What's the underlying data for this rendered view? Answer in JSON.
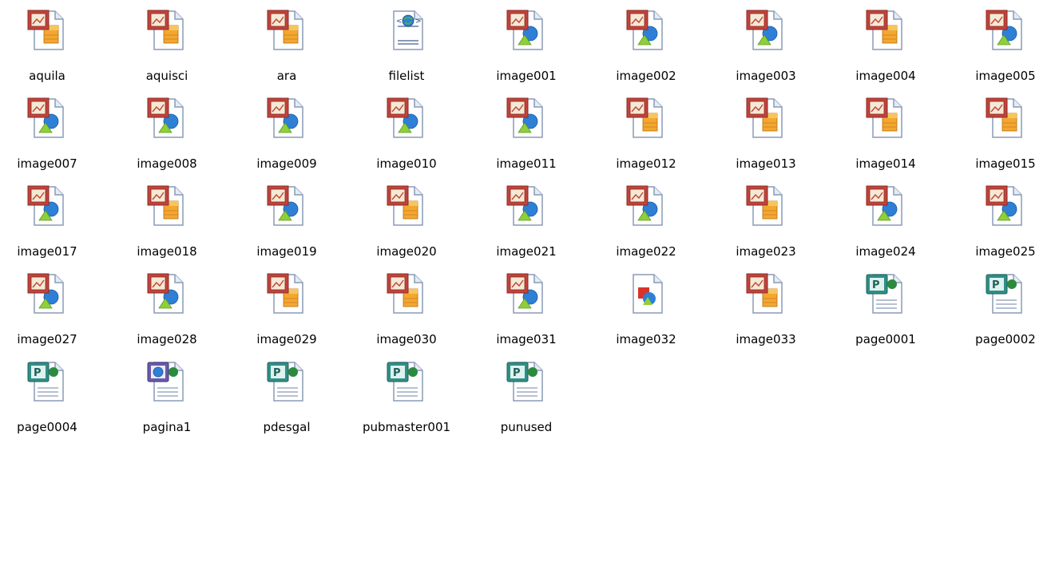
{
  "files": [
    {
      "name": "aquila",
      "icon": "image-bitmap-icon"
    },
    {
      "name": "aquisci",
      "icon": "image-bitmap-icon"
    },
    {
      "name": "ara",
      "icon": "image-bitmap-icon"
    },
    {
      "name": "filelist",
      "icon": "xml-document-icon"
    },
    {
      "name": "image001",
      "icon": "image-picture-icon"
    },
    {
      "name": "image002",
      "icon": "image-picture-icon"
    },
    {
      "name": "image003",
      "icon": "image-picture-icon"
    },
    {
      "name": "image004",
      "icon": "image-bitmap-icon"
    },
    {
      "name": "image005",
      "icon": "image-picture-icon"
    },
    {
      "name": "image007",
      "icon": "image-picture-icon"
    },
    {
      "name": "image008",
      "icon": "image-picture-icon"
    },
    {
      "name": "image009",
      "icon": "image-picture-icon"
    },
    {
      "name": "image010",
      "icon": "image-picture-icon"
    },
    {
      "name": "image011",
      "icon": "image-picture-icon"
    },
    {
      "name": "image012",
      "icon": "image-bitmap-icon"
    },
    {
      "name": "image013",
      "icon": "image-bitmap-icon"
    },
    {
      "name": "image014",
      "icon": "image-bitmap-icon"
    },
    {
      "name": "image015",
      "icon": "image-bitmap-icon"
    },
    {
      "name": "image017",
      "icon": "image-picture-icon"
    },
    {
      "name": "image018",
      "icon": "image-bitmap-icon"
    },
    {
      "name": "image019",
      "icon": "image-picture-icon"
    },
    {
      "name": "image020",
      "icon": "image-bitmap-icon"
    },
    {
      "name": "image021",
      "icon": "image-picture-icon"
    },
    {
      "name": "image022",
      "icon": "image-picture-icon"
    },
    {
      "name": "image023",
      "icon": "image-bitmap-icon"
    },
    {
      "name": "image024",
      "icon": "image-picture-icon"
    },
    {
      "name": "image025",
      "icon": "image-picture-icon"
    },
    {
      "name": "image027",
      "icon": "image-picture-icon"
    },
    {
      "name": "image028",
      "icon": "image-picture-icon"
    },
    {
      "name": "image029",
      "icon": "image-bitmap-icon"
    },
    {
      "name": "image030",
      "icon": "image-bitmap-icon"
    },
    {
      "name": "image031",
      "icon": "image-picture-icon"
    },
    {
      "name": "image032",
      "icon": "image-shape-icon"
    },
    {
      "name": "image033",
      "icon": "image-bitmap-icon"
    },
    {
      "name": "page0001",
      "icon": "publisher-document-icon"
    },
    {
      "name": "page0002",
      "icon": "publisher-document-icon"
    },
    {
      "name": "page0004",
      "icon": "publisher-document-icon"
    },
    {
      "name": "pagina1",
      "icon": "publisher-web-document-icon"
    },
    {
      "name": "pdesgal",
      "icon": "publisher-document-icon"
    },
    {
      "name": "pubmaster001",
      "icon": "publisher-document-icon"
    },
    {
      "name": "punused",
      "icon": "publisher-document-icon"
    }
  ]
}
